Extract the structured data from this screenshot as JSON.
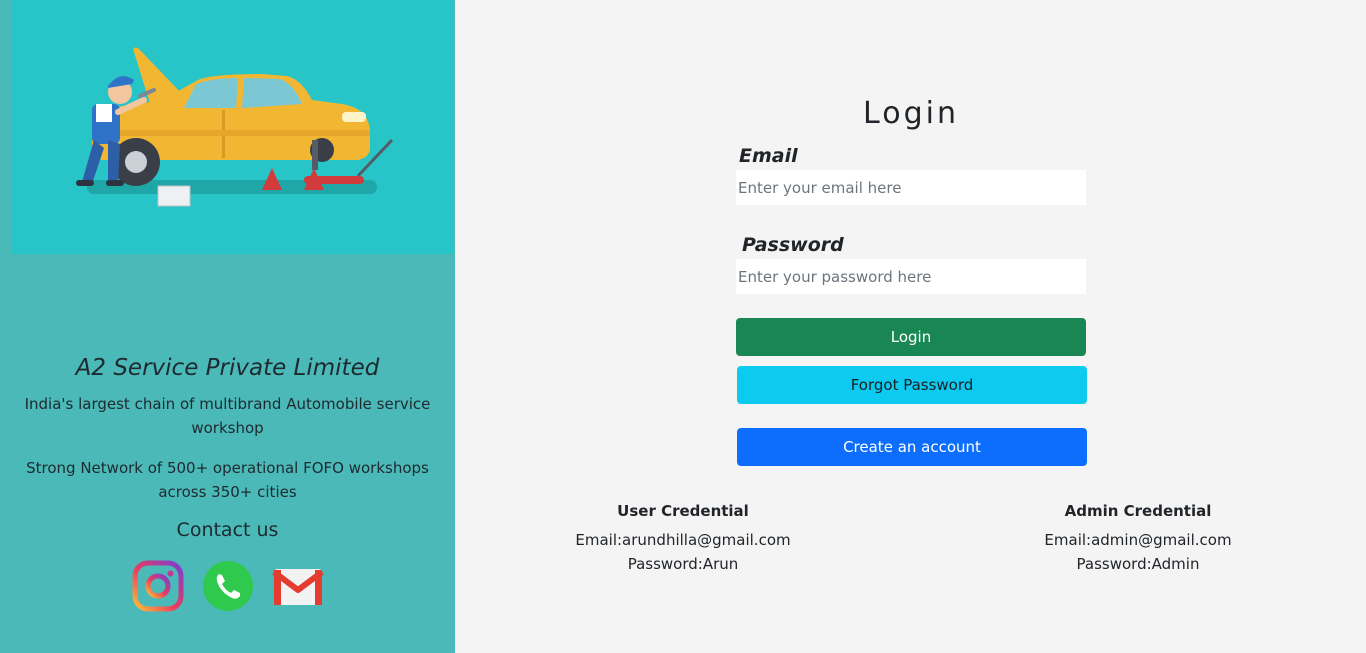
{
  "brand": {
    "name": "A2 Service Private Limited",
    "tagline_1": "India's largest chain of multibrand Automobile service workshop",
    "tagline_2": "Strong Network of 500+ operational FOFO workshops across 350+ cities"
  },
  "contact": {
    "title": "Contact us",
    "icons": [
      "instagram-icon",
      "whatsapp-icon",
      "gmail-icon"
    ]
  },
  "login": {
    "title": "Login",
    "email_label": "Email",
    "email_placeholder": "Enter your email here",
    "password_label": "Password",
    "password_placeholder": "Enter your password here",
    "login_button": "Login",
    "forgot_button": "Forgot Password",
    "create_button": "Create an account"
  },
  "credentials": {
    "user": {
      "title": "User Credential",
      "email": "Email:arundhilla@gmail.com",
      "password": "Password:Arun"
    },
    "admin": {
      "title": "Admin Credential",
      "email": "Email:admin@gmail.com",
      "password": "Password:Admin"
    }
  },
  "colors": {
    "left_panel": "#4ab9b8",
    "hero_bg": "#27c5c8",
    "login_button": "#198754",
    "forgot_button": "#0dcaf0",
    "create_button": "#0d6efd"
  }
}
